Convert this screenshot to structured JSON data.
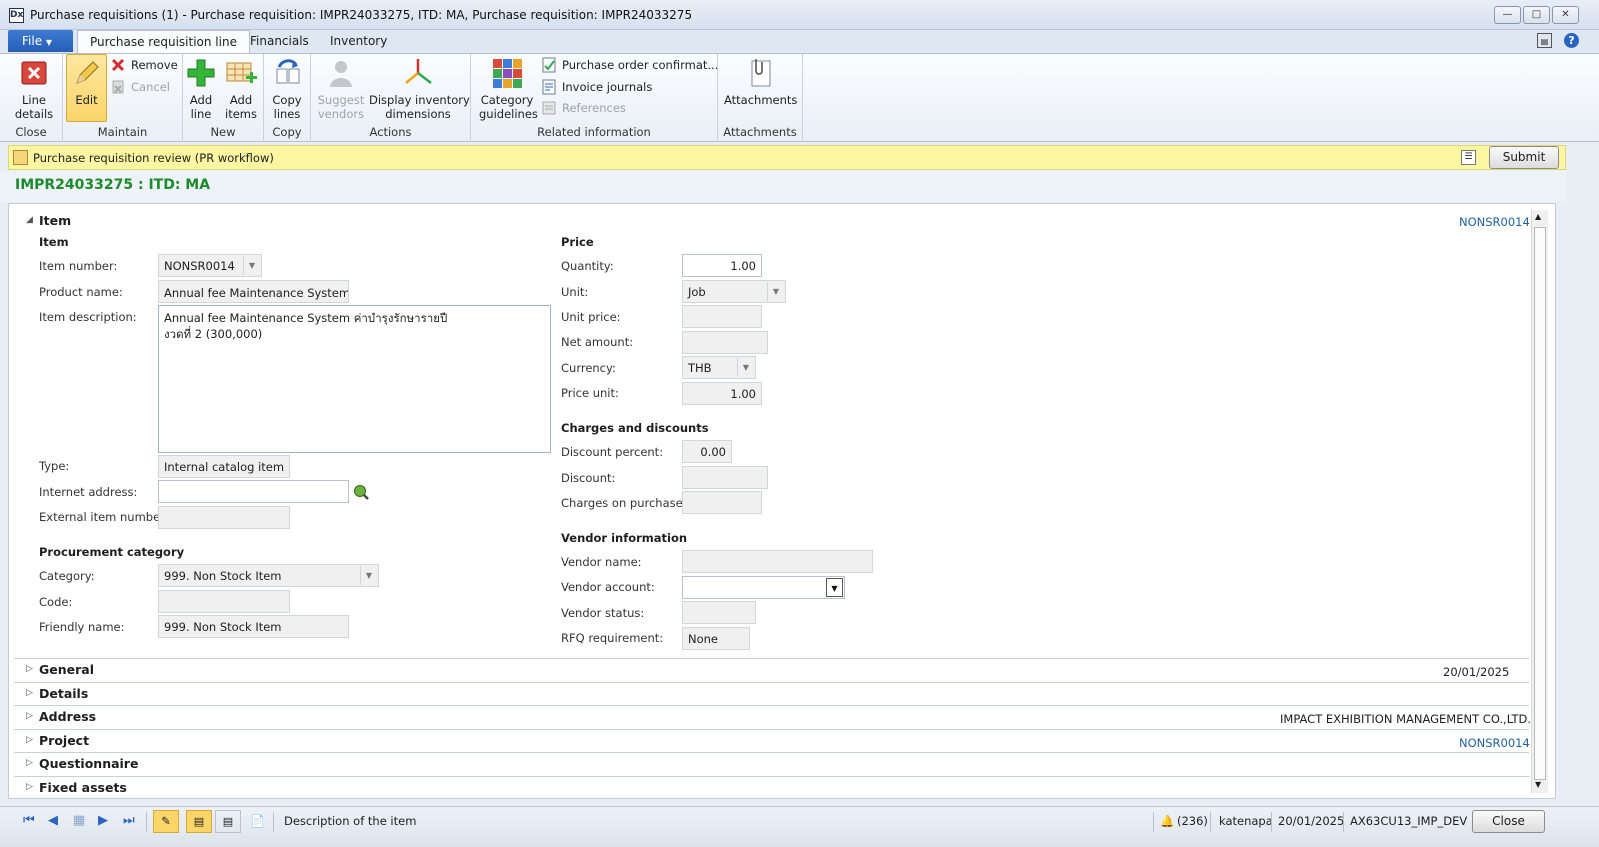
{
  "window": {
    "title": "Purchase requisitions (1) - Purchase requisition: IMPR24033275, ITD: MA, Purchase requisition: IMPR24033275",
    "app_icon": "Dx"
  },
  "ribbon_tabs": {
    "file": "File",
    "tabs": [
      "Purchase requisition line",
      "Financials",
      "Inventory"
    ]
  },
  "ribbon": {
    "close_group": {
      "label": "Close",
      "line_details": "Line\ndetails"
    },
    "maintain_group": {
      "label": "Maintain",
      "edit": "Edit",
      "remove": "Remove",
      "cancel": "Cancel"
    },
    "new_group": {
      "label": "New",
      "add_line": "Add\nline",
      "add_items": "Add\nitems"
    },
    "copy_group": {
      "label": "Copy",
      "copy_lines": "Copy\nlines"
    },
    "actions_group": {
      "label": "Actions",
      "suggest_vendors": "Suggest\nvendors",
      "display_inventory_dimensions": "Display inventory\ndimensions"
    },
    "related_group": {
      "label": "Related information",
      "category_guidelines": "Category\nguidelines",
      "po_confirmations": "Purchase order confirmat...",
      "invoice_journals": "Invoice journals",
      "references": "References"
    },
    "attachments_group": {
      "label": "Attachments",
      "attachments": "Attachments"
    }
  },
  "workflow": {
    "text": "Purchase requisition review (PR workflow)",
    "submit": "Submit"
  },
  "record_title": "IMPR24033275 : ITD: MA",
  "item_tab": {
    "header": "Item",
    "summary": "NONSR0014",
    "item_group": "Item",
    "labels": {
      "item_number": "Item number:",
      "product_name": "Product name:",
      "item_description": "Item description:",
      "type": "Type:",
      "internet_address": "Internet address:",
      "external_item_number": "External item number:"
    },
    "values": {
      "item_number": "NONSR0014",
      "product_name": "Annual fee Maintenance System ค่",
      "item_description": "Annual fee Maintenance System ค่าบำรุงรักษารายปี\nงวดที่ 2 (300,000)",
      "type": "Internal catalog item",
      "internet_address": "",
      "external_item_number": ""
    },
    "procurement_group": "Procurement category",
    "proc_labels": {
      "category": "Category:",
      "code": "Code:",
      "friendly_name": "Friendly name:"
    },
    "proc_values": {
      "category": "999. Non Stock Item",
      "code": "",
      "friendly_name": "999. Non Stock Item"
    },
    "price_group": "Price",
    "price_labels": {
      "quantity": "Quantity:",
      "unit": "Unit:",
      "unit_price": "Unit price:",
      "net_amount": "Net amount:",
      "currency": "Currency:",
      "price_unit": "Price unit:"
    },
    "price_values": {
      "quantity": "1.00",
      "unit": "Job",
      "unit_price": "",
      "net_amount": "",
      "currency": "THB",
      "price_unit": "1.00"
    },
    "charges_group": "Charges and discounts",
    "charges_labels": {
      "discount_percent": "Discount percent:",
      "discount": "Discount:",
      "charges_on_purchases": "Charges on purchases:"
    },
    "charges_values": {
      "discount_percent": "0.00",
      "discount": "",
      "charges_on_purchases": ""
    },
    "vendor_group": "Vendor information",
    "vendor_labels": {
      "vendor_name": "Vendor name:",
      "vendor_account": "Vendor account:",
      "vendor_status": "Vendor status:",
      "rfq_requirement": "RFQ requirement:"
    },
    "vendor_values": {
      "vendor_name": "",
      "vendor_account": "",
      "vendor_status": "",
      "rfq_requirement": "None"
    }
  },
  "fasttabs": [
    {
      "label": "General",
      "summary": "20/01/2025"
    },
    {
      "label": "Details",
      "summary": ""
    },
    {
      "label": "Address",
      "summary": "IMPACT EXHIBITION MANAGEMENT CO.,LTD."
    },
    {
      "label": "Project",
      "summary": "NONSR0014"
    },
    {
      "label": "Questionnaire",
      "summary": ""
    },
    {
      "label": "Fixed assets",
      "summary": ""
    }
  ],
  "statusbar": {
    "help_text": "Description of the item",
    "notifications": "(236)",
    "user": "katenapa",
    "date": "20/01/2025",
    "environment": "AX63CU13_IMP_DEV",
    "close": "Close"
  },
  "colors": {
    "title_green": "#1d8a2c",
    "workflow_yellow": "#fbf6a1",
    "file_blue": "#2f6bc6",
    "link_blue": "#1f5f9e"
  }
}
